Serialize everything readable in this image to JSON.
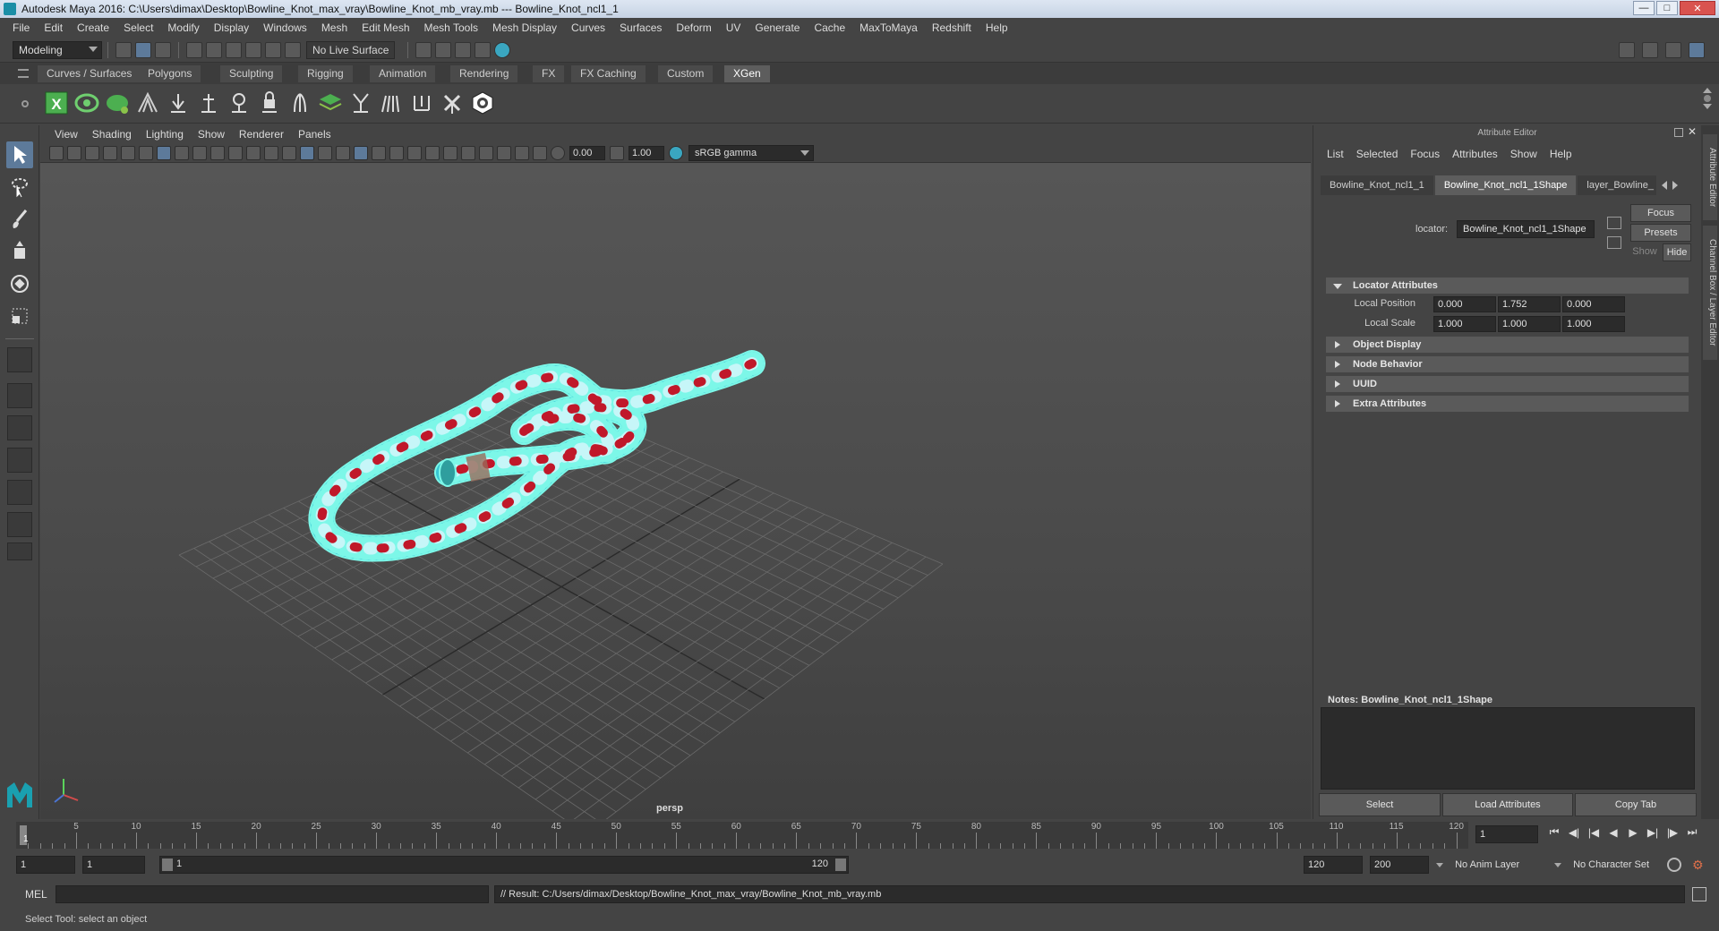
{
  "window": {
    "title": "Autodesk Maya 2016: C:\\Users\\dimax\\Desktop\\Bowline_Knot_max_vray\\Bowline_Knot_mb_vray.mb  ---  Bowline_Knot_ncl1_1"
  },
  "menubar": [
    "File",
    "Edit",
    "Create",
    "Select",
    "Modify",
    "Display",
    "Windows",
    "Mesh",
    "Edit Mesh",
    "Mesh Tools",
    "Mesh Display",
    "Curves",
    "Surfaces",
    "Deform",
    "UV",
    "Generate",
    "Cache",
    "MaxToMaya",
    "Redshift",
    "Help"
  ],
  "statusline": {
    "menu_set": "Modeling",
    "live_surface": "No Live Surface"
  },
  "shelf": {
    "tabs": [
      "Curves / Surfaces",
      "Polygons",
      "Sculpting",
      "Rigging",
      "Animation",
      "Rendering",
      "FX",
      "FX Caching",
      "Custom",
      "XGen"
    ],
    "active_tab": "XGen"
  },
  "viewport": {
    "menu": [
      "View",
      "Shading",
      "Lighting",
      "Show",
      "Renderer",
      "Panels"
    ],
    "exposure": "0.00",
    "gamma": "1.00",
    "color_space": "sRGB gamma",
    "camera_label": "persp",
    "colors": {
      "mesh": "#38c6d4",
      "wire": "#7cf7e8",
      "dots": "#c0182a"
    }
  },
  "attribute_editor": {
    "title": "Attribute Editor",
    "menu": [
      "List",
      "Selected",
      "Focus",
      "Attributes",
      "Show",
      "Help"
    ],
    "tabs": [
      "Bowline_Knot_ncl1_1",
      "Bowline_Knot_ncl1_1Shape",
      "layer_Bowline_"
    ],
    "active_tab": "Bowline_Knot_ncl1_1Shape",
    "buttons": {
      "focus": "Focus",
      "presets": "Presets",
      "show": "Show",
      "hide": "Hide"
    },
    "locator_label": "locator:",
    "locator_value": "Bowline_Knot_ncl1_1Shape",
    "sections": {
      "locator_attributes": "Locator Attributes",
      "object_display": "Object Display",
      "node_behavior": "Node Behavior",
      "uuid": "UUID",
      "extra_attributes": "Extra Attributes"
    },
    "local_position": {
      "label": "Local Position",
      "x": "0.000",
      "y": "1.752",
      "z": "0.000"
    },
    "local_scale": {
      "label": "Local Scale",
      "x": "1.000",
      "y": "1.000",
      "z": "1.000"
    },
    "notes_label": "Notes:  Bowline_Knot_ncl1_1Shape",
    "bottom_buttons": {
      "select": "Select",
      "load": "Load Attributes",
      "copy": "Copy Tab"
    },
    "side_tabs": [
      "Attribute Editor",
      "Channel Box / Layer Editor"
    ]
  },
  "timeline": {
    "ticks": [
      "5",
      "10",
      "15",
      "20",
      "25",
      "30",
      "35",
      "40",
      "45",
      "50",
      "55",
      "60",
      "65",
      "70",
      "75",
      "80",
      "85",
      "90",
      "95",
      "100",
      "105",
      "110",
      "115",
      "120"
    ],
    "start_marker": "1",
    "current_frame": "1"
  },
  "range": {
    "start": "1",
    "playback_start": "1",
    "slider_start": "1",
    "slider_end": "120",
    "playback_end": "120",
    "end": "200",
    "anim_layer": "No Anim Layer",
    "character_set": "No Character Set"
  },
  "command_line": {
    "label": "MEL",
    "result": "// Result: C:/Users/dimax/Desktop/Bowline_Knot_max_vray/Bowline_Knot_mb_vray.mb"
  },
  "help_line": "Select Tool: select an object"
}
